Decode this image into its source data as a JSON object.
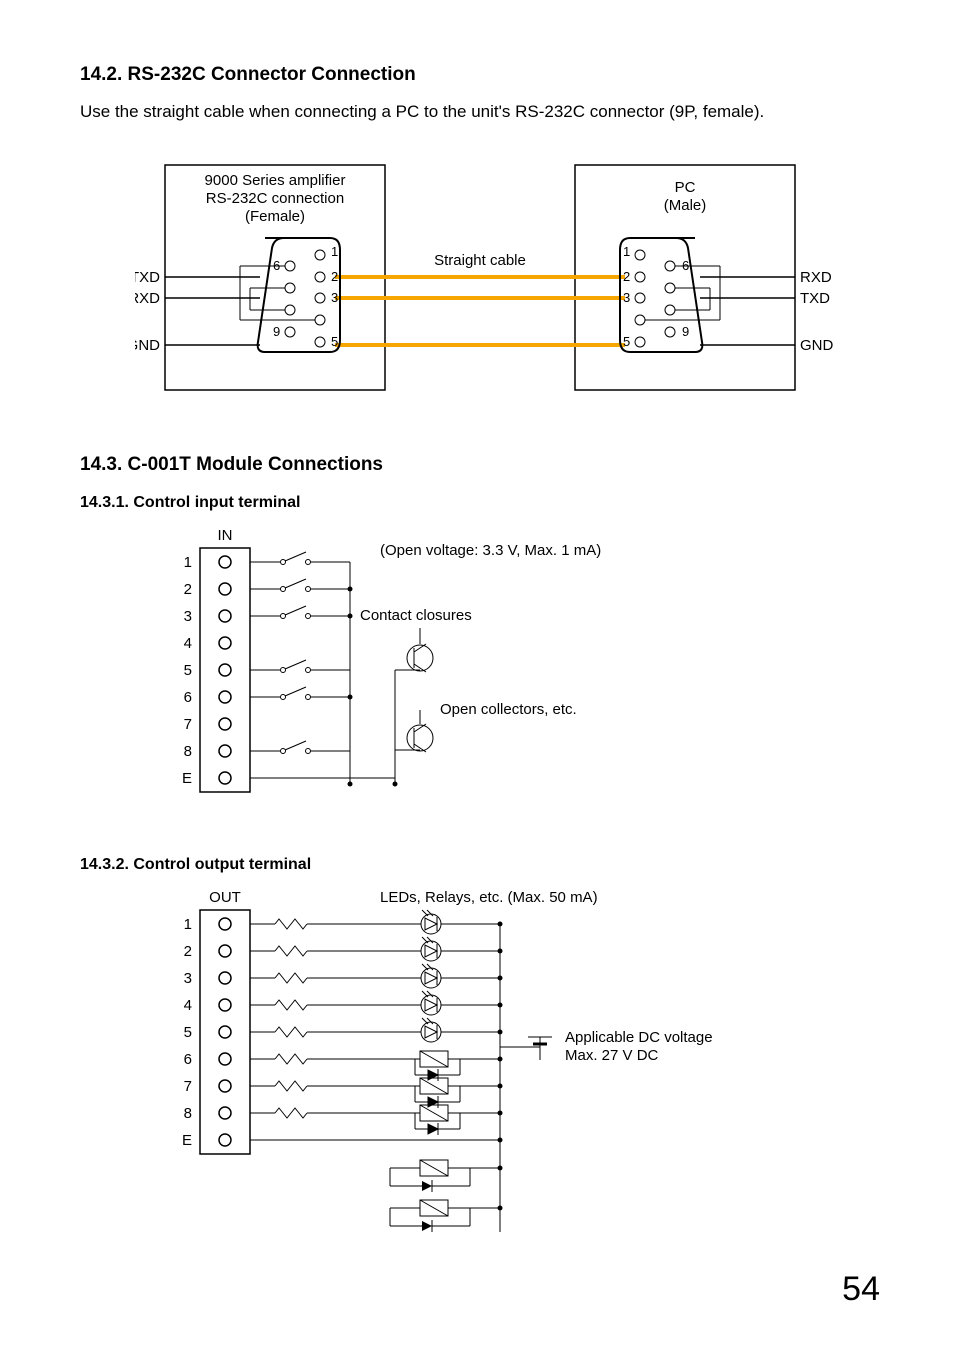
{
  "section142": {
    "heading": "14.2. RS-232C Connector Connection",
    "intro": "Use the straight cable when connecting a PC to the unit's RS-232C connector (9P, female).",
    "left_box": {
      "line1": "9000 Series amplifier",
      "line2": "RS-232C connection",
      "line3": "(Female)"
    },
    "right_box": {
      "line1": "PC",
      "line2": "(Male)"
    },
    "straight_cable": "Straight cable",
    "signals_left": {
      "txd": "TXD",
      "rxd": "RXD",
      "gnd": "GND"
    },
    "signals_right": {
      "rxd": "RXD",
      "txd": "TXD",
      "gnd": "GND"
    },
    "pins": {
      "p1": "1",
      "p2": "2",
      "p3": "3",
      "p5": "5",
      "p6": "6",
      "p9": "9"
    }
  },
  "section143": {
    "heading": "14.3. C-001T Module Connections",
    "sub1": {
      "heading": "14.3.1. Control input terminal",
      "tbl_label": "IN",
      "open_voltage": "(Open voltage: 3.3 V, Max. 1 mA)",
      "contact_closures": "Contact closures",
      "open_collectors": "Open collectors, etc.",
      "rows": [
        "1",
        "2",
        "3",
        "4",
        "5",
        "6",
        "7",
        "8",
        "E"
      ]
    },
    "sub2": {
      "heading": "14.3.2. Control output terminal",
      "tbl_label": "OUT",
      "loads": "LEDs, Relays, etc. (Max. 50 mA)",
      "voltage1": "Applicable DC voltage",
      "voltage2": "Max. 27 V DC",
      "rows": [
        "1",
        "2",
        "3",
        "4",
        "5",
        "6",
        "7",
        "8",
        "E"
      ]
    }
  },
  "page_number": "54"
}
